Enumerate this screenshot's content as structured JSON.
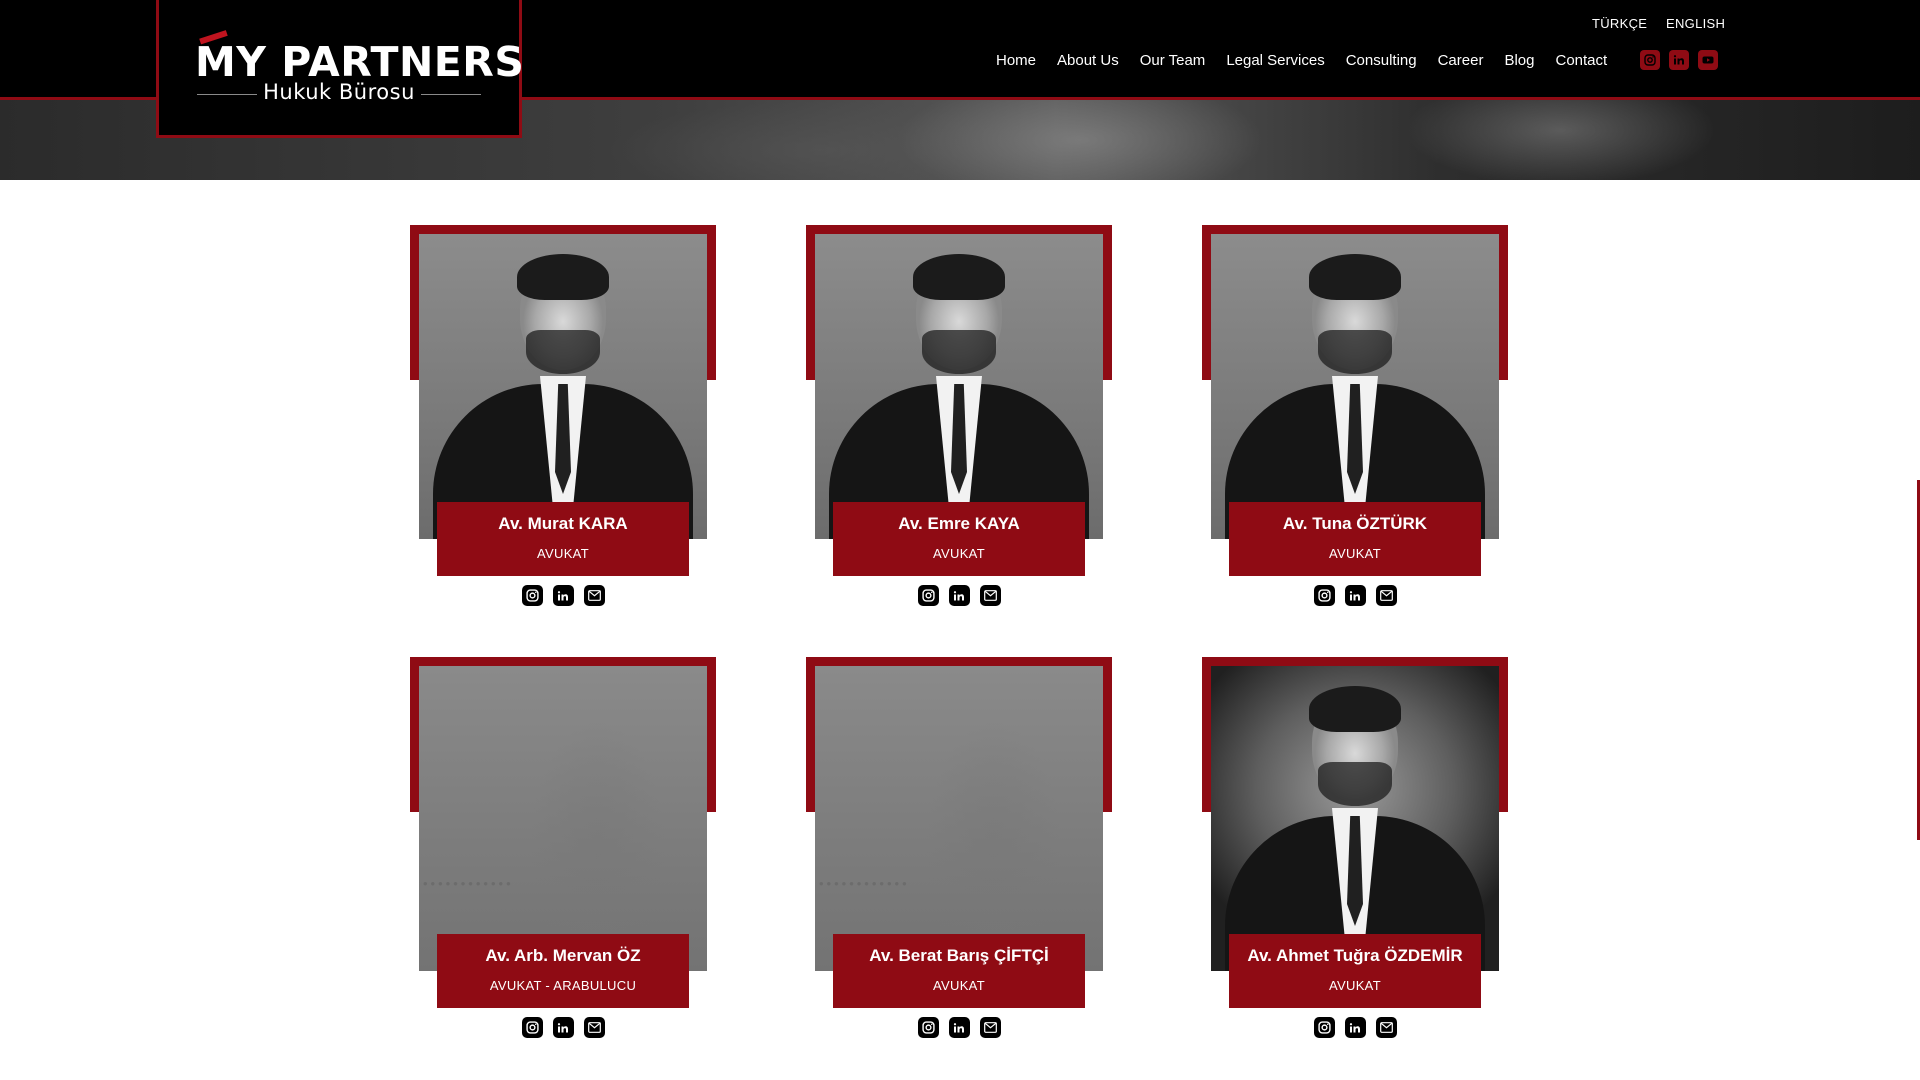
{
  "brand": {
    "logo_main": "MY PARTNERS",
    "logo_sub": "Hukuk Bürosu",
    "accent_color": "#8f0b14"
  },
  "languages": [
    "TÜRKÇE",
    "ENGLISH"
  ],
  "nav": {
    "items": [
      "Home",
      "About Us",
      "Our Team",
      "Legal Services",
      "Consulting",
      "Career",
      "Blog",
      "Contact"
    ]
  },
  "header_social": [
    "instagram-icon",
    "linkedin-icon",
    "youtube-icon"
  ],
  "team": [
    {
      "name": "Av. Murat KARA",
      "role": "AVUKAT",
      "photo": "portrait"
    },
    {
      "name": "Av. Emre KAYA",
      "role": "AVUKAT",
      "photo": "portrait"
    },
    {
      "name": "Av. Tuna ÖZTÜRK",
      "role": "AVUKAT",
      "photo": "portrait"
    },
    {
      "name": "Av. Arb. Mervan ÖZ",
      "role": "AVUKAT - ARABULUCU",
      "photo": "placeholder"
    },
    {
      "name": "Av. Berat Barış ÇİFTÇİ",
      "role": "AVUKAT",
      "photo": "placeholder"
    },
    {
      "name": "Av. Ahmet Tuğra ÖZDEMİR",
      "role": "AVUKAT",
      "photo": "portrait-dark"
    }
  ],
  "card_social": [
    "instagram-icon",
    "linkedin-icon",
    "email-icon"
  ]
}
